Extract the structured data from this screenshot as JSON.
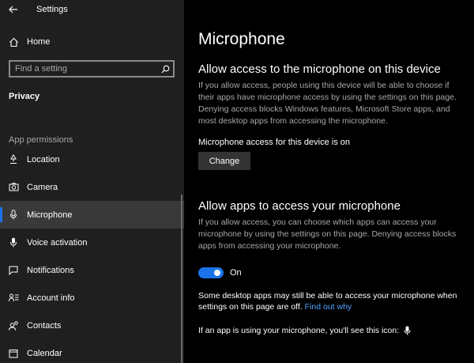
{
  "window": {
    "title": "Settings"
  },
  "sidebar": {
    "home_label": "Home",
    "search": {
      "placeholder": "Find a setting",
      "value": ""
    },
    "category": "Privacy",
    "section_label": "App permissions",
    "items": [
      {
        "label": "Location",
        "icon": "location-pin-icon"
      },
      {
        "label": "Camera",
        "icon": "camera-icon"
      },
      {
        "label": "Microphone",
        "icon": "microphone-icon",
        "selected": true
      },
      {
        "label": "Voice activation",
        "icon": "voice-mic-icon"
      },
      {
        "label": "Notifications",
        "icon": "notification-icon"
      },
      {
        "label": "Account info",
        "icon": "account-info-icon"
      },
      {
        "label": "Contacts",
        "icon": "contacts-icon"
      },
      {
        "label": "Calendar",
        "icon": "calendar-icon"
      }
    ]
  },
  "main": {
    "title": "Microphone",
    "device_section": {
      "heading": "Allow access to the microphone on this device",
      "description": "If you allow access, people using this device will be able to choose if their apps have microphone access by using the settings on this page. Denying access blocks Windows features, Microsoft Store apps, and most desktop apps from accessing the microphone.",
      "status": "Microphone access for this device is on",
      "button_label": "Change"
    },
    "apps_section": {
      "heading": "Allow apps to access your microphone",
      "description": "If you allow access, you can choose which apps can access your microphone by using the settings on this page. Denying access blocks apps from accessing your microphone.",
      "toggle_state": "On",
      "toggle_on": true,
      "note": "Some desktop apps may still be able to access your microphone when settings on this page are off.",
      "link": "Find out why",
      "icon_note": "If an app is using your microphone, you'll see this icon:"
    }
  },
  "colors": {
    "accent": "#1a73e8",
    "link": "#4da3ff",
    "sidebar_bg": "#1f1f1f",
    "main_bg": "#000000"
  }
}
